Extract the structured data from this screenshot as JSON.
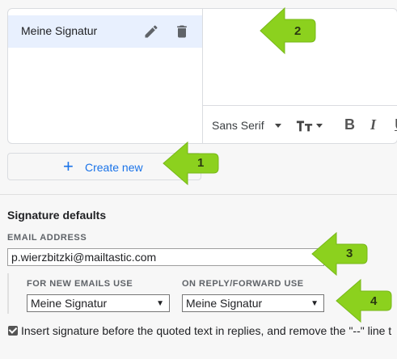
{
  "signatures": {
    "items": [
      {
        "label": "Meine Signatur"
      }
    ]
  },
  "icons": {
    "edit": "pencil-icon",
    "delete": "trash-icon",
    "create": "plus-icon"
  },
  "toolbar": {
    "font": "Sans Serif",
    "bold": "B",
    "italic": "I",
    "underline": "U"
  },
  "create_new": {
    "label": "Create new"
  },
  "defaults": {
    "title": "Signature defaults",
    "email_label": "EMAIL ADDRESS",
    "email_value": "p.wierzbitzki@mailtastic.com",
    "new_emails_label": "FOR NEW EMAILS USE",
    "new_emails_value": "Meine Signatur",
    "reply_label": "ON REPLY/FORWARD USE",
    "reply_value": "Meine Signatur",
    "caret": "▼"
  },
  "insert_option": {
    "label": "Insert signature before the quoted text in replies, and remove the \"--\" line t",
    "checked": true
  },
  "callouts": [
    "1",
    "2",
    "3",
    "4"
  ],
  "colors": {
    "accent": "#1a73e8",
    "callout_green": "#8cd11e",
    "selected_bg": "#e8f0fe"
  }
}
